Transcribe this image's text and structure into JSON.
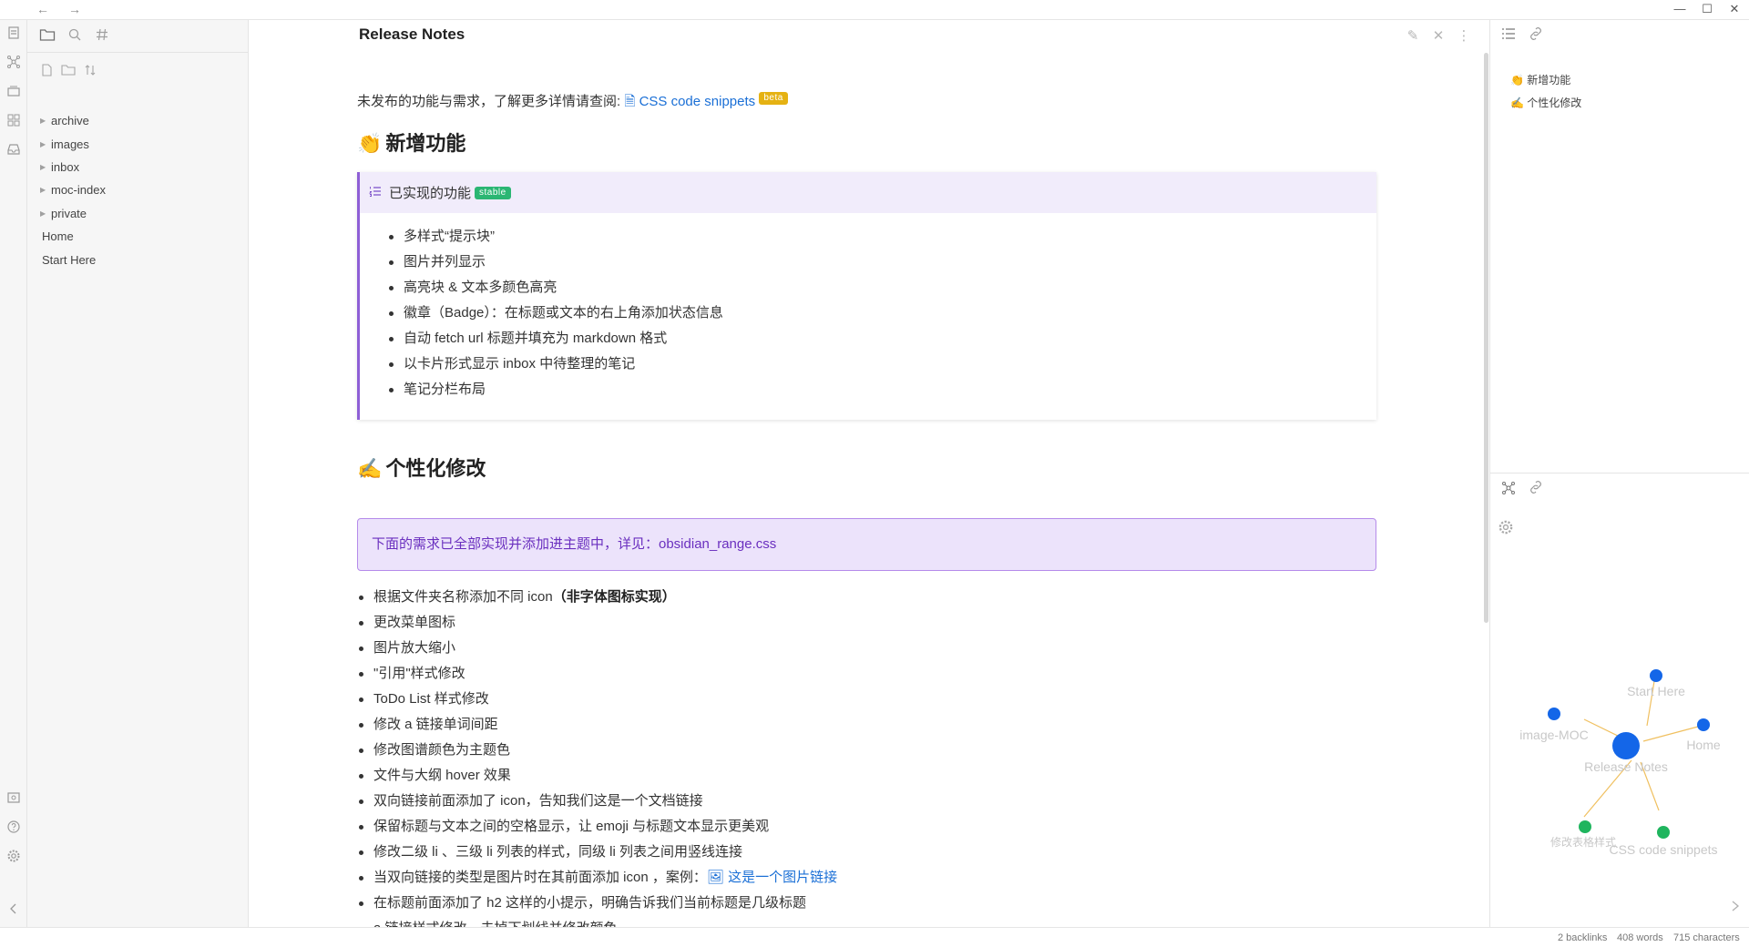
{
  "titlebar": {
    "back": "←",
    "forward": "→",
    "minimize": "—",
    "maximize": "☐",
    "close": "✕"
  },
  "explorer": {
    "tree": [
      {
        "label": "archive",
        "type": "folder"
      },
      {
        "label": "images",
        "type": "folder"
      },
      {
        "label": "inbox",
        "type": "folder"
      },
      {
        "label": "moc-index",
        "type": "folder"
      },
      {
        "label": "private",
        "type": "folder"
      },
      {
        "label": "Home",
        "type": "file"
      },
      {
        "label": "Start Here",
        "type": "file"
      }
    ]
  },
  "editor": {
    "title": "Release Notes",
    "intro_text": "未发布的功能与需求，了解更多详情请查阅: ",
    "intro_link": "CSS code snippets",
    "intro_badge": "beta",
    "section1_emoji": "👏",
    "section1_title": "新增功能",
    "callout_title": "已实现的功能",
    "callout_badge": "stable",
    "callout_items": [
      "多样式“提示块”",
      "图片并列显示",
      "高亮块 & 文本多颜色高亮",
      "徽章（Badge）：在标题或文本的右上角添加状态信息",
      "自动 fetch url 标题并填充为 markdown 格式",
      "以卡片形式显示 inbox 中待整理的笔记",
      "笔记分栏布局"
    ],
    "section2_emoji": "✍️",
    "section2_title": "个性化修改",
    "note_text": "下面的需求已全部实现并添加进主题中，详见：obsidian_range.css",
    "list_item_1_text": "根据文件夹名称添加不同 icon",
    "list_item_1_bold": "（非字体图标实现）",
    "list_items": [
      "更改菜单图标",
      "图片放大缩小",
      "\"引用\"样式修改",
      "ToDo List 样式修改",
      "修改 a 链接单词间距",
      "修改图谱颜色为主题色",
      "文件与大纲 hover 效果",
      "双向链接前面添加了 icon，告知我们这是一个文档链接",
      "保留标题与文本之间的空格显示，让 emoji 与标题文本显示更美观",
      "修改二级 li 、三级 li 列表的样式，同级 li 列表之间用竖线连接"
    ],
    "list_item_img_text": "当双向链接的类型是图片时在其前面添加 icon ，案例：",
    "list_item_img_link": "这是一个图片链接",
    "list_items_tail": [
      "在标题前面添加了 h2 这样的小提示，明确告诉我们当前标题是几级标题",
      "a 链接样式修改，去掉下划线并修改颜色"
    ]
  },
  "outline": [
    {
      "emoji": "👏",
      "label": "新增功能"
    },
    {
      "emoji": "✍️",
      "label": "个性化修改"
    }
  ],
  "graph": {
    "nodes": [
      "Start Here",
      "image-MOC",
      "Home",
      "Release Notes",
      "修改表格样式",
      "CSS code snippets"
    ],
    "colors": {
      "node": "#1466e8",
      "tag": "#1fb55e",
      "edge": "#f0c060",
      "label": "#c8c8c8"
    }
  },
  "statusbar": {
    "backlinks": "2 backlinks",
    "words": "408 words",
    "characters": "715 characters"
  },
  "colors": {
    "accent": "#8e5fd6",
    "link": "#1a6fd6",
    "badge_beta": "#e5b213",
    "badge_stable": "#2bb673"
  }
}
